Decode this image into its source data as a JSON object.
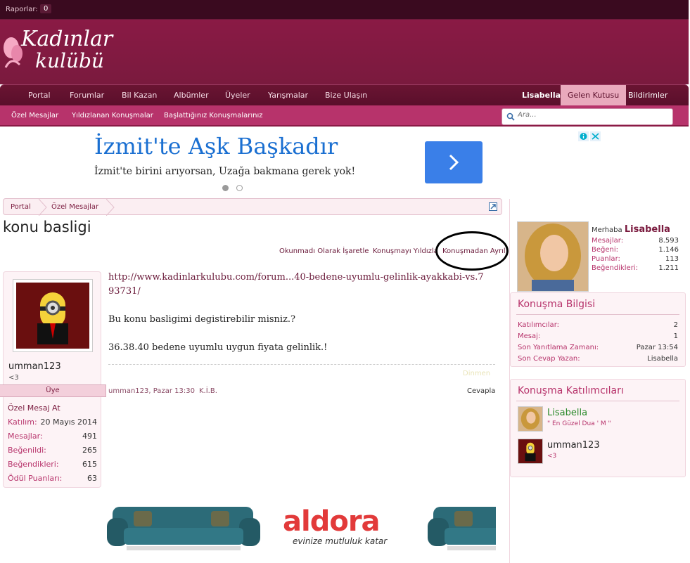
{
  "topbar": {
    "reports_label": "Raporlar:",
    "reports_count": "0"
  },
  "logo": {
    "line1": "Kadınlar",
    "line2": "kulübü"
  },
  "nav": {
    "items": [
      "Portal",
      "Forumlar",
      "Bil Kazan",
      "Albümler",
      "Üyeler",
      "Yarışmalar",
      "Bize Ulaşın"
    ],
    "user": "Lisabella",
    "inbox": "Gelen Kutusu",
    "alerts": "Bildirimler"
  },
  "subnav": {
    "items": [
      "Özel Mesajlar",
      "Yıldızlanan Konuşmalar",
      "Başlattığınız Konuşmalarınız"
    ]
  },
  "search": {
    "placeholder": "Ara..."
  },
  "ad_top": {
    "headline": "İzmit'te Aşk Başkadır",
    "subline": "İzmit'te birini arıyorsan, Uzağa bakmana gerek yok!"
  },
  "breadcrumb": {
    "items": [
      "Portal",
      "Özel Mesajlar"
    ]
  },
  "thread": {
    "title": "konu basligi",
    "actions": [
      "Okunmadı Olarak İşaretle",
      "Konuşmayı Yıldızla",
      "Konuşmadan Ayrıl"
    ]
  },
  "post": {
    "author": "umman123",
    "author_status": "<3",
    "role": "Üye",
    "send_pm": "Özel Mesaj At",
    "stats": [
      {
        "k": "Katılım:",
        "v": "20 Mayıs 2014"
      },
      {
        "k": "Mesajlar:",
        "v": "491"
      },
      {
        "k": "Beğenildi:",
        "v": "265"
      },
      {
        "k": "Beğendikleri:",
        "v": "615"
      },
      {
        "k": "Ödül Puanları:",
        "v": "63"
      }
    ],
    "link": "http://www.kadinlarkulubu.com/forum...40-bedene-uyumlu-gelinlik-ayakkabi-vs.793731/",
    "line1": "Bu konu basligimi degistirebilir misniz.?",
    "line2": "36.38.40 bedene uyumlu uygun fiyata gelinlik.!",
    "ghost": "Dinmen",
    "meta": "umman123, Pazar 13:30",
    "meta2": "K.İ.B.",
    "reply": "Cevapla"
  },
  "ad_bottom": {
    "brand": "aldora",
    "tagline": "evinize mutluluk katar"
  },
  "profile": {
    "hello": "Merhaba",
    "name": "Lisabella",
    "stats": [
      {
        "k": "Mesajlar:",
        "v": "8.593"
      },
      {
        "k": "Beğeni:",
        "v": "1.146"
      },
      {
        "k": "Puanlar:",
        "v": "113"
      },
      {
        "k": "Beğendikleri:",
        "v": "1.211"
      }
    ]
  },
  "conv_info": {
    "title": "Konuşma Bilgisi",
    "rows": [
      {
        "k": "Katılımcılar:",
        "v": "2"
      },
      {
        "k": "Mesaj:",
        "v": "1"
      },
      {
        "k": "Son Yanıtlama Zamanı:",
        "v": "Pazar 13:54"
      },
      {
        "k": "Son Cevap Yazan:",
        "v": "Lisabella"
      }
    ]
  },
  "participants": {
    "title": "Konuşma Katılımcıları",
    "items": [
      {
        "name": "Lisabella",
        "status": "\" En Güzel Dua ' M \"",
        "color": "#2a8a2a"
      },
      {
        "name": "umman123",
        "status": "<3",
        "color": "#222222"
      }
    ]
  }
}
